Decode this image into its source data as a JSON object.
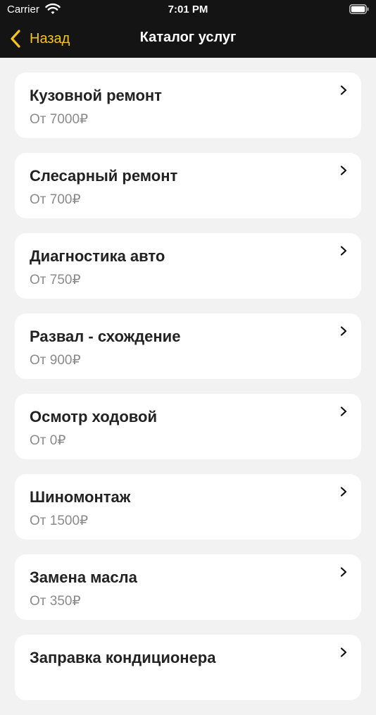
{
  "status_bar": {
    "carrier": "Carrier",
    "time": "7:01 PM"
  },
  "nav": {
    "back_label": "Назад",
    "title": "Каталог услуг",
    "accent_color": "#f5c518",
    "background_color": "#141414"
  },
  "services": [
    {
      "title": "Кузовной ремонт",
      "price": "От 7000₽"
    },
    {
      "title": "Слесарный ремонт",
      "price": "От 700₽"
    },
    {
      "title": "Диагностика авто",
      "price": "От 750₽"
    },
    {
      "title": "Развал - схождение",
      "price": "От 900₽"
    },
    {
      "title": "Осмотр ходовой",
      "price": "От 0₽"
    },
    {
      "title": "Шиномонтаж",
      "price": "От 1500₽"
    },
    {
      "title": "Замена масла",
      "price": "От 350₽"
    },
    {
      "title": "Заправка кондиционера",
      "price": ""
    }
  ],
  "icons": {
    "wifi": "wifi-icon",
    "battery": "battery-icon",
    "back": "chevron-left-icon",
    "row_disclosure": "chevron-right-icon"
  }
}
